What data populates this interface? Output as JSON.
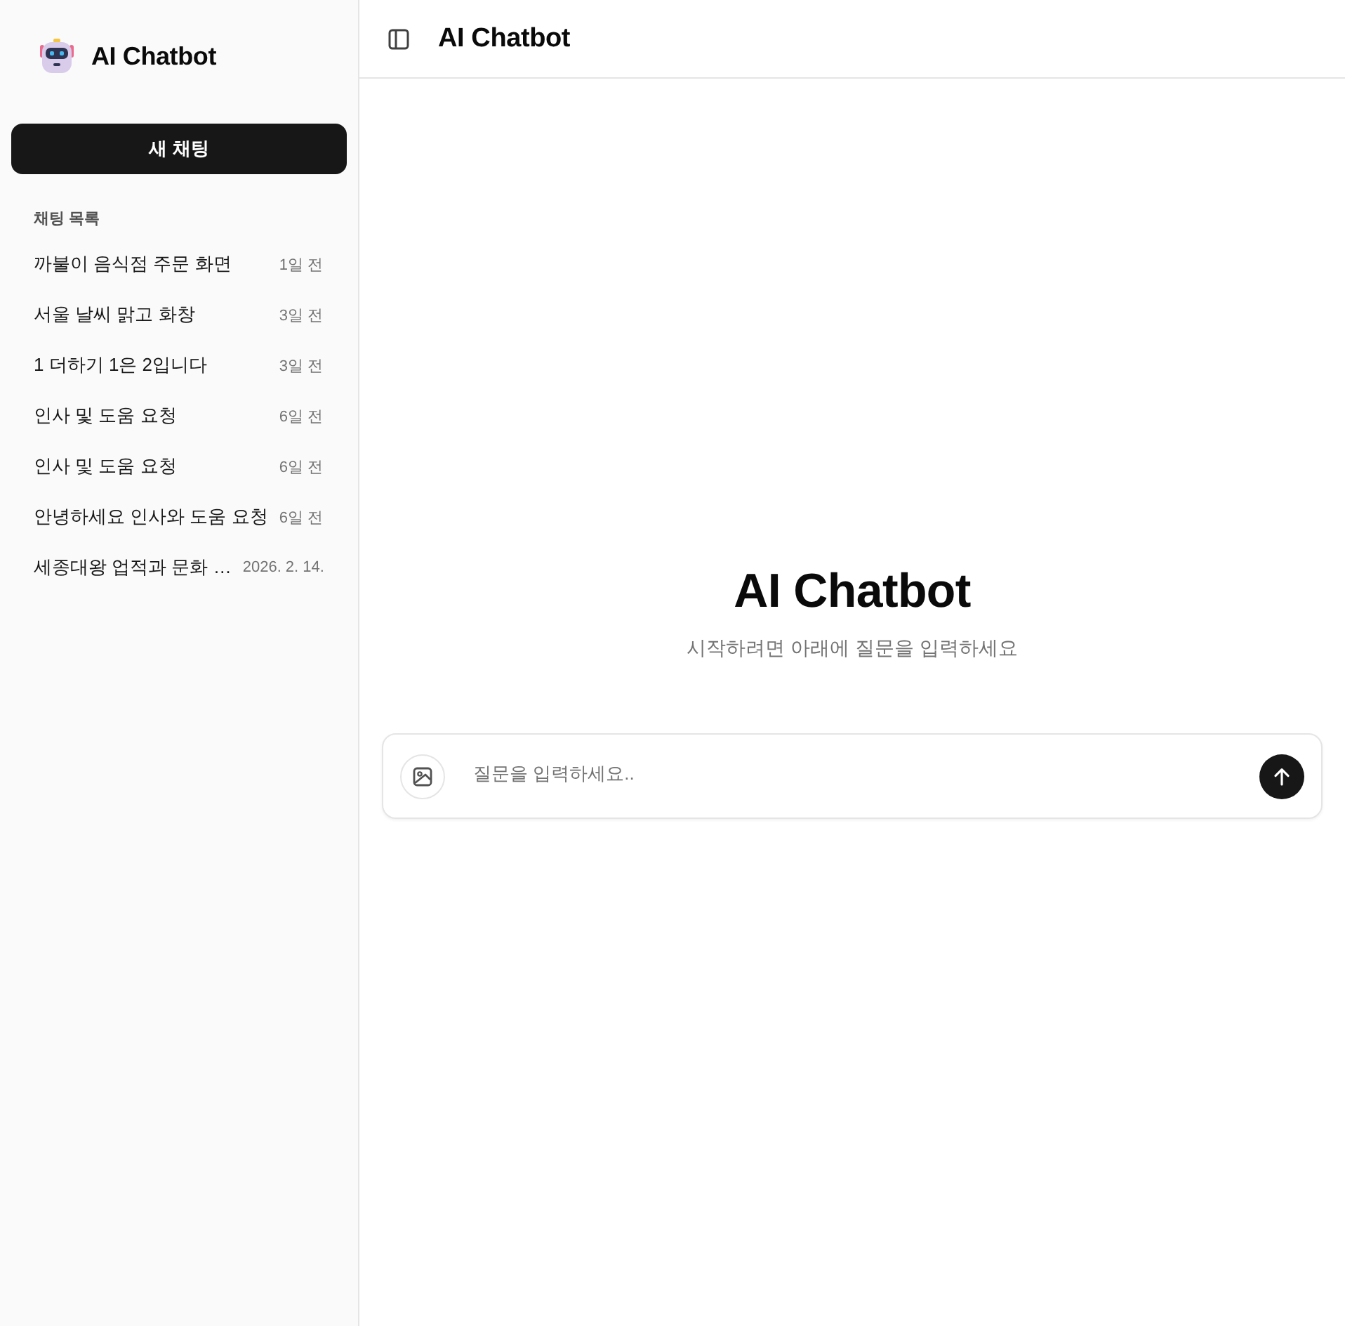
{
  "sidebar": {
    "brand": "AI Chatbot",
    "new_chat_button": "새 채팅",
    "section_label": "채팅 목록",
    "chats": [
      {
        "title": "까불이 음식점 주문 화면",
        "time": "1일 전",
        "selected": false
      },
      {
        "title": "서울 날씨 맑고 화창",
        "time": "3일 전",
        "selected": false
      },
      {
        "title": "1 더하기 1은 2입니다",
        "time": "3일 전",
        "selected": false
      },
      {
        "title": "인사 및 도움 요청",
        "time": "6일 전",
        "selected": false
      },
      {
        "title": "인사 및 도움 요청",
        "time": "6일 전",
        "selected": false
      },
      {
        "title": "안녕하세요 인사와 도움 요청",
        "time": "6일 전",
        "selected": false
      },
      {
        "title": "세종대왕 업적과 문화 …",
        "time": "2026. 2. 14.",
        "selected": false
      }
    ]
  },
  "header": {
    "title": "AI Chatbot"
  },
  "welcome": {
    "title": "AI Chatbot",
    "subtitle": "시작하려면 아래에 질문을 입력하세요"
  },
  "composer": {
    "placeholder": "질문을 입력하세요.."
  }
}
